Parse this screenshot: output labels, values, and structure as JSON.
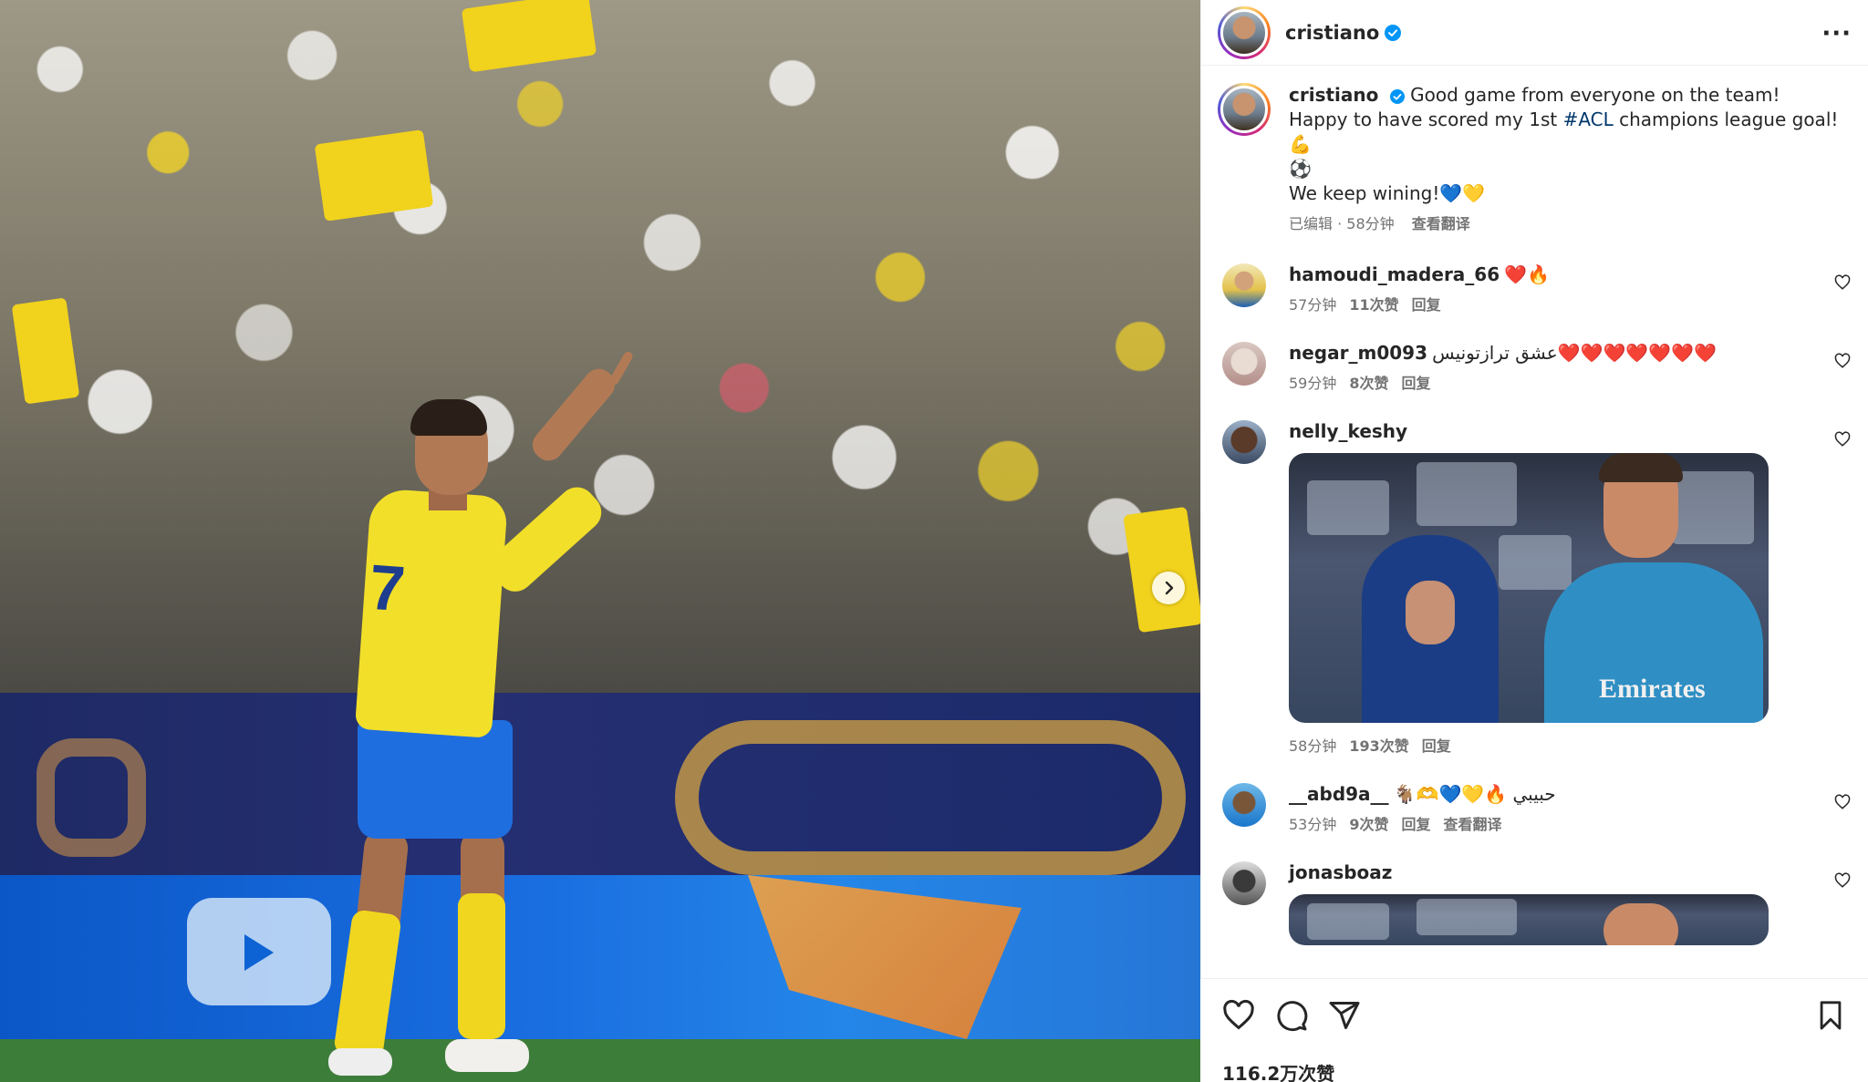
{
  "post": {
    "author": "cristiano",
    "verified": true,
    "caption_line1": "Good game from everyone on the team!",
    "caption_line2_pre": "Happy to have scored my 1st ",
    "caption_hashtag": "#ACL",
    "caption_line2_post": " champions league goal!💪",
    "caption_line3": "⚽",
    "caption_line4": "We keep wining!💙💛",
    "meta_edited": "已编辑 · 58分钟",
    "meta_translate": "查看翻译"
  },
  "media": {
    "jersey_number": "7",
    "billboard_brand": "Emirates"
  },
  "comments": [
    {
      "username": "hamoudi_madera_66",
      "text": "❤️🔥",
      "time": "57分钟",
      "likes": "11次赞",
      "reply": "回复"
    },
    {
      "username": "negar_m0093",
      "text": "عشق ترازتونیس❤️❤️❤️❤️❤️❤️❤️",
      "time": "59分钟",
      "likes": "8次赞",
      "reply": "回复"
    },
    {
      "username": "nelly_keshy",
      "text": "",
      "time": "58分钟",
      "likes": "193次赞",
      "reply": "回复",
      "gif_text": "Emirates"
    },
    {
      "username": "__abd9a__",
      "text": "🐐🫶💙💛🔥 حبيبي",
      "time": "53分钟",
      "likes": "9次赞",
      "reply": "回复",
      "translate": "查看翻译"
    },
    {
      "username": "jonasboaz",
      "text": ""
    }
  ],
  "footer": {
    "likes_count": "116.2万次赞"
  },
  "icons": {
    "more": "more-options-icon",
    "next": "chevron-right-icon",
    "heart": "heart-icon",
    "comment": "comment-icon",
    "share": "share-icon",
    "save": "bookmark-icon"
  }
}
